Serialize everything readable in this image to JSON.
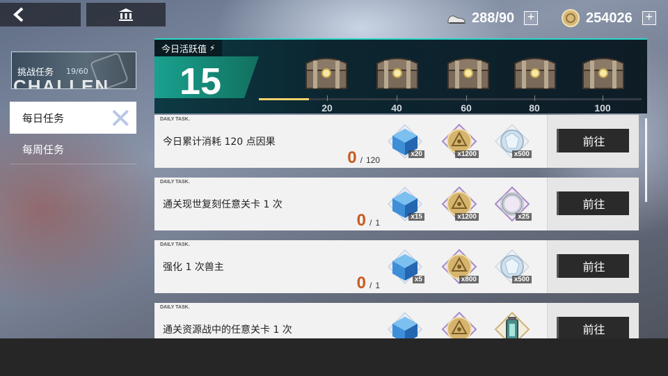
{
  "nav": {
    "back_icon": "back-arrow-icon",
    "home_icon": "museum-icon"
  },
  "resources": {
    "stamina": {
      "icon": "sneaker-icon",
      "value": "288/90",
      "plus": "+"
    },
    "coins": {
      "icon": "coin-icon",
      "value": "254026",
      "plus": "+"
    }
  },
  "sidebar": {
    "challenge": {
      "label": "挑战任务",
      "count": "19/60",
      "deco_text": "CHALLEN"
    },
    "items": [
      {
        "label": "每日任务",
        "active": true
      },
      {
        "label": "每周任务",
        "active": false
      }
    ]
  },
  "activity": {
    "label": "今日活跃值",
    "value": "15",
    "progress_fraction": 0.13,
    "milestones": [
      "20",
      "40",
      "60",
      "80",
      "100"
    ]
  },
  "tasks": [
    {
      "tag": "DAILY TASK.",
      "title": "今日累计消耗 120 点因果",
      "current": "0",
      "sep": "/",
      "total": "120",
      "rewards": [
        {
          "icon": "blue-cube-icon",
          "qty": "x20"
        },
        {
          "icon": "gold-eye-coin-icon",
          "qty": "x1200"
        },
        {
          "icon": "crystal-orb-icon",
          "qty": "x500"
        }
      ],
      "button": "前往"
    },
    {
      "tag": "DAILY TASK.",
      "title": "通关现世复刻任意关卡 1 次",
      "current": "0",
      "sep": "/",
      "total": "1",
      "rewards": [
        {
          "icon": "blue-cube-icon",
          "qty": "x15"
        },
        {
          "icon": "gold-eye-coin-icon",
          "qty": "x1200"
        },
        {
          "icon": "silver-ring-icon",
          "qty": "x25"
        }
      ],
      "button": "前往"
    },
    {
      "tag": "DAILY TASK.",
      "title": "强化 1 次兽主",
      "current": "0",
      "sep": "/",
      "total": "1",
      "rewards": [
        {
          "icon": "blue-cube-icon",
          "qty": "x5"
        },
        {
          "icon": "gold-eye-coin-icon",
          "qty": "x800"
        },
        {
          "icon": "crystal-orb-icon",
          "qty": "x500"
        }
      ],
      "button": "前往"
    },
    {
      "tag": "DAILY TASK.",
      "title": "通关资源战中的任意关卡 1 次",
      "current": "",
      "sep": "",
      "total": "",
      "rewards": [
        {
          "icon": "blue-cube-icon",
          "qty": ""
        },
        {
          "icon": "gold-eye-coin-icon",
          "qty": ""
        },
        {
          "icon": "lantern-icon",
          "qty": ""
        }
      ],
      "button": "前往"
    }
  ]
}
